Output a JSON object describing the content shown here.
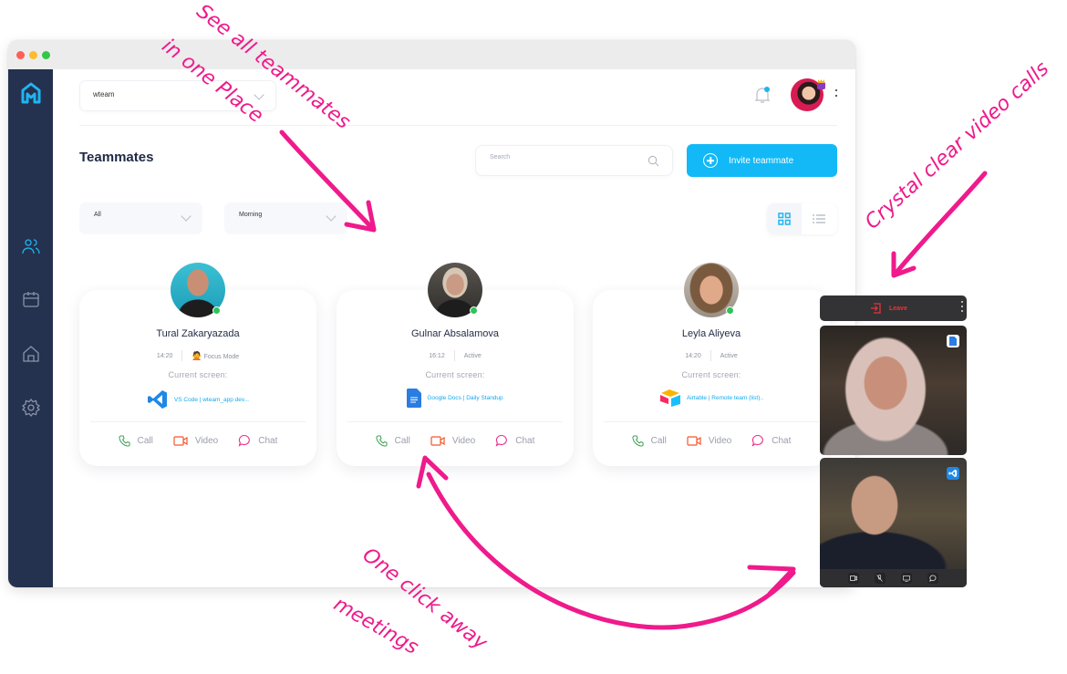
{
  "window": {
    "traffic_lights": [
      "close",
      "minimize",
      "maximize"
    ]
  },
  "sidebar": {
    "logo": "wteam-logo",
    "items": [
      {
        "name": "teammates",
        "icon": "users-icon",
        "active": true
      },
      {
        "name": "calendar",
        "icon": "calendar-icon",
        "active": false
      },
      {
        "name": "office",
        "icon": "home-icon",
        "active": false
      },
      {
        "name": "settings",
        "icon": "gear-icon",
        "active": false
      }
    ]
  },
  "header": {
    "workspace_select": "wteam",
    "notification_badge": true
  },
  "page": {
    "title": "Teammates",
    "search_placeholder": "Search",
    "invite_label": "Invite teammate",
    "filters": [
      {
        "value": "All"
      },
      {
        "value": "Morning"
      }
    ],
    "view_modes": [
      "grid",
      "list"
    ],
    "active_view": "grid"
  },
  "teammates": [
    {
      "name": "Tural Zakaryazada",
      "time": "14:20",
      "status": "Focus Mode",
      "status_emoji": "🙅",
      "current_screen_label": "Current screen:",
      "app": "VS Code | wteam_app dev...",
      "app_icon": "vscode-icon",
      "online": true
    },
    {
      "name": "Gulnar Absalamova",
      "time": "16:12",
      "status": "Active",
      "current_screen_label": "Current screen:",
      "app": "Google Docs | Daily Standup",
      "app_icon": "google-docs-icon",
      "online": true
    },
    {
      "name": "Leyla Aliyeva",
      "time": "14:20",
      "status": "Active",
      "current_screen_label": "Current screen:",
      "app": "Airtable | Remote team (list)..",
      "app_icon": "airtable-icon",
      "online": true
    }
  ],
  "actions": {
    "call": "Call",
    "video": "Video",
    "chat": "Chat"
  },
  "video_call": {
    "leave_label": "Leave",
    "controls": [
      "camera",
      "mic-off",
      "screen-share",
      "chat"
    ]
  },
  "annotations": {
    "see_all_1": "See all teammates",
    "see_all_2": "in one Place",
    "crystal": "Crystal clear video calls",
    "one_click": "One click away",
    "meetings": "meetings"
  },
  "colors": {
    "accent": "#12b9f6",
    "sidebar": "#24324f",
    "annotation": "#ef1a8b",
    "online": "#2ec35a",
    "call": "#2f9a46",
    "video": "#f2582d",
    "chat": "#ea2e8c",
    "leave": "#e8363a"
  }
}
